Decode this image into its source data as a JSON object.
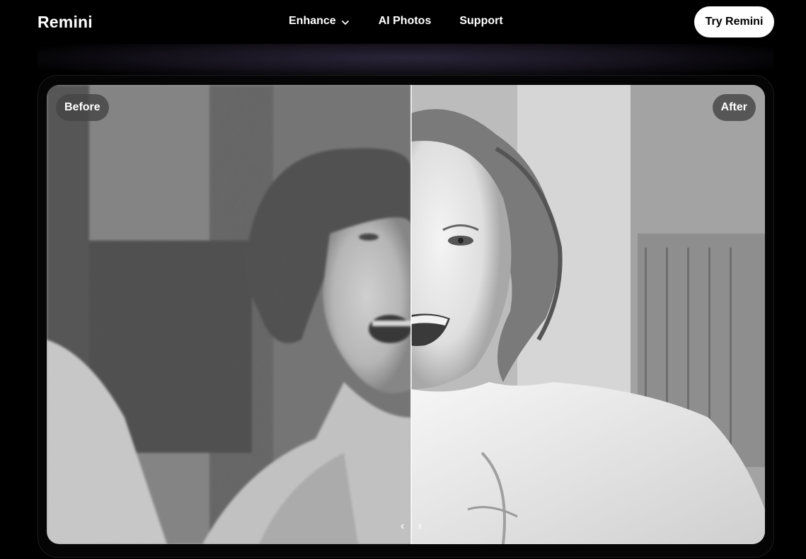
{
  "header": {
    "logo": "Remini",
    "nav": [
      {
        "label": "Enhance",
        "has_dropdown": true
      },
      {
        "label": "AI Photos"
      },
      {
        "label": "Support"
      }
    ],
    "cta_label": "Try Remini"
  },
  "comparer": {
    "before_label": "Before",
    "after_label": "After",
    "handle_left": "‹",
    "handle_right": "›"
  },
  "colors": {
    "background": "#000000",
    "button_bg": "#ffffff",
    "tag_bg": "#464646"
  }
}
